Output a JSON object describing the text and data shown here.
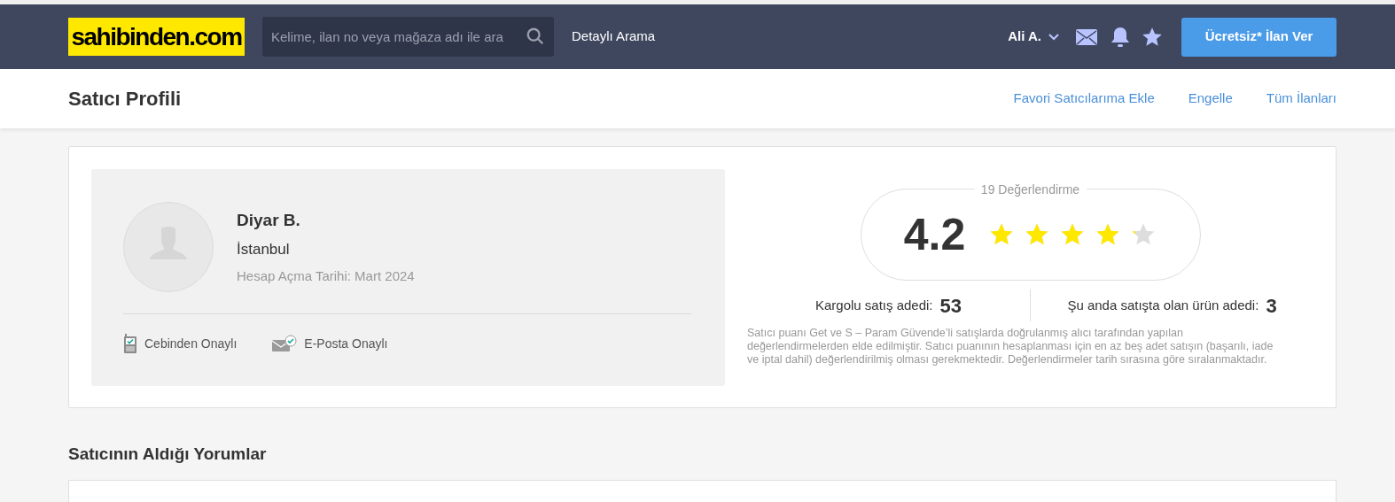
{
  "header": {
    "logo": "sahibinden.com",
    "search": {
      "placeholder": "Kelime, ilan no veya mağaza adı ile ara"
    },
    "detailed_search": "Detaylı Arama",
    "user": "Ali A.",
    "post_button": "Ücretsiz* İlan Ver"
  },
  "subheader": {
    "title": "Satıcı Profili",
    "links": [
      "Favori Satıcılarıma Ekle",
      "Engelle",
      "Tüm İlanları"
    ]
  },
  "seller": {
    "name": "Diyar B.",
    "city": "İstanbul",
    "joined": "Hesap Açma Tarihi: Mart 2024",
    "badges": [
      {
        "kind": "phone",
        "label": "Cebinden Onaylı"
      },
      {
        "kind": "email",
        "label": "E-Posta Onaylı"
      }
    ]
  },
  "rating": {
    "count_label": "19 Değerlendirme",
    "score": "4.2",
    "stars": 4.2
  },
  "stats": [
    {
      "label": "Kargolu satış adedi:",
      "value": "53"
    },
    {
      "label": "Şu anda satışta olan ürün adedi:",
      "value": "3"
    }
  ],
  "note": "Satıcı puanı Get ve S – Param Güvende’li satışlarda doğrulanmış alıcı tarafından yapılan değerlendirmelerden elde edilmiştir. Satıcı puanının hesaplanması için en az beş adet satışın (başarılı, iade ve iptal dahil) değerlendirilmiş olması gerekmektedir. Değerlendirmeler tarih sırasına göre sıralanmaktadır.",
  "reviews_heading": "Satıcının Aldığı Yorumlar"
}
